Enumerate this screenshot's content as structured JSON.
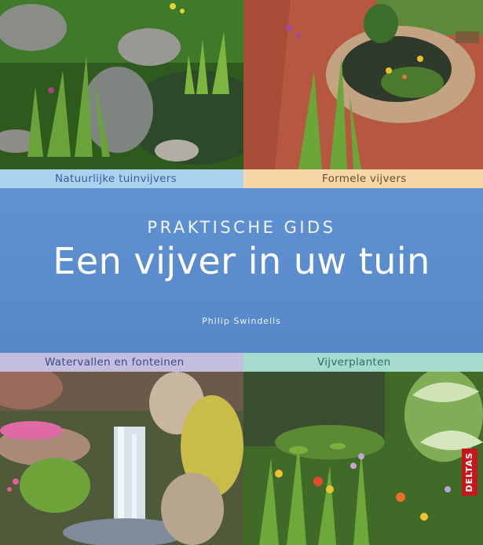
{
  "cover": {
    "kicker": "PRAKTISCHE GIDS",
    "title": "Een vijver in uw tuin",
    "author": "Philip Swindells",
    "publisher": "DELTAS"
  },
  "categories": {
    "top_left": "Natuurlijke tuinvijvers",
    "top_right": "Formele vijvers",
    "bottom_left": "Watervallen en fonteinen",
    "bottom_right": "Vijverplanten"
  },
  "colors": {
    "band": "#5b8fd0",
    "strip_top_left": "#a9d2ee",
    "strip_top_right": "#f5d7a8",
    "strip_bottom_left": "#c3bde0",
    "strip_bottom_right": "#a6dccf",
    "publisher_red": "#c7161c"
  }
}
